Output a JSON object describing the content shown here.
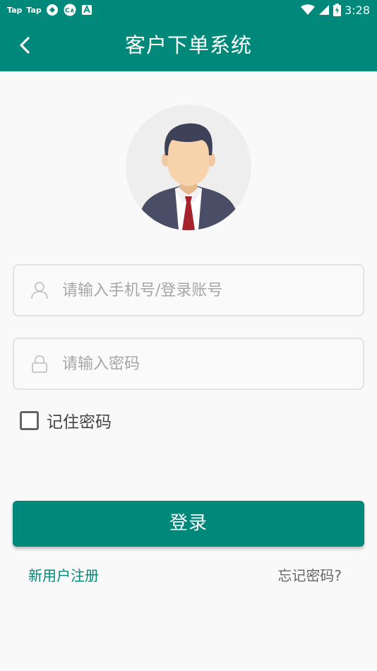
{
  "status_bar": {
    "icons": [
      "taptap-icon",
      "taptap-icon",
      "app-icon",
      "app-icon",
      "app-icon"
    ],
    "tap1": "Tap",
    "tap2": "Tap",
    "time": "3:28"
  },
  "header": {
    "title": "客户下单系统",
    "back_icon": "chevron-left-icon"
  },
  "form": {
    "account_placeholder": "请输入手机号/登录账号",
    "password_placeholder": "请输入密码",
    "remember_label": "记住密码",
    "remember_checked": false,
    "login_label": "登录"
  },
  "links": {
    "register": "新用户注册",
    "forgot": "忘记密码?"
  },
  "colors": {
    "primary": "#00897b",
    "background": "#f9f9f9"
  }
}
